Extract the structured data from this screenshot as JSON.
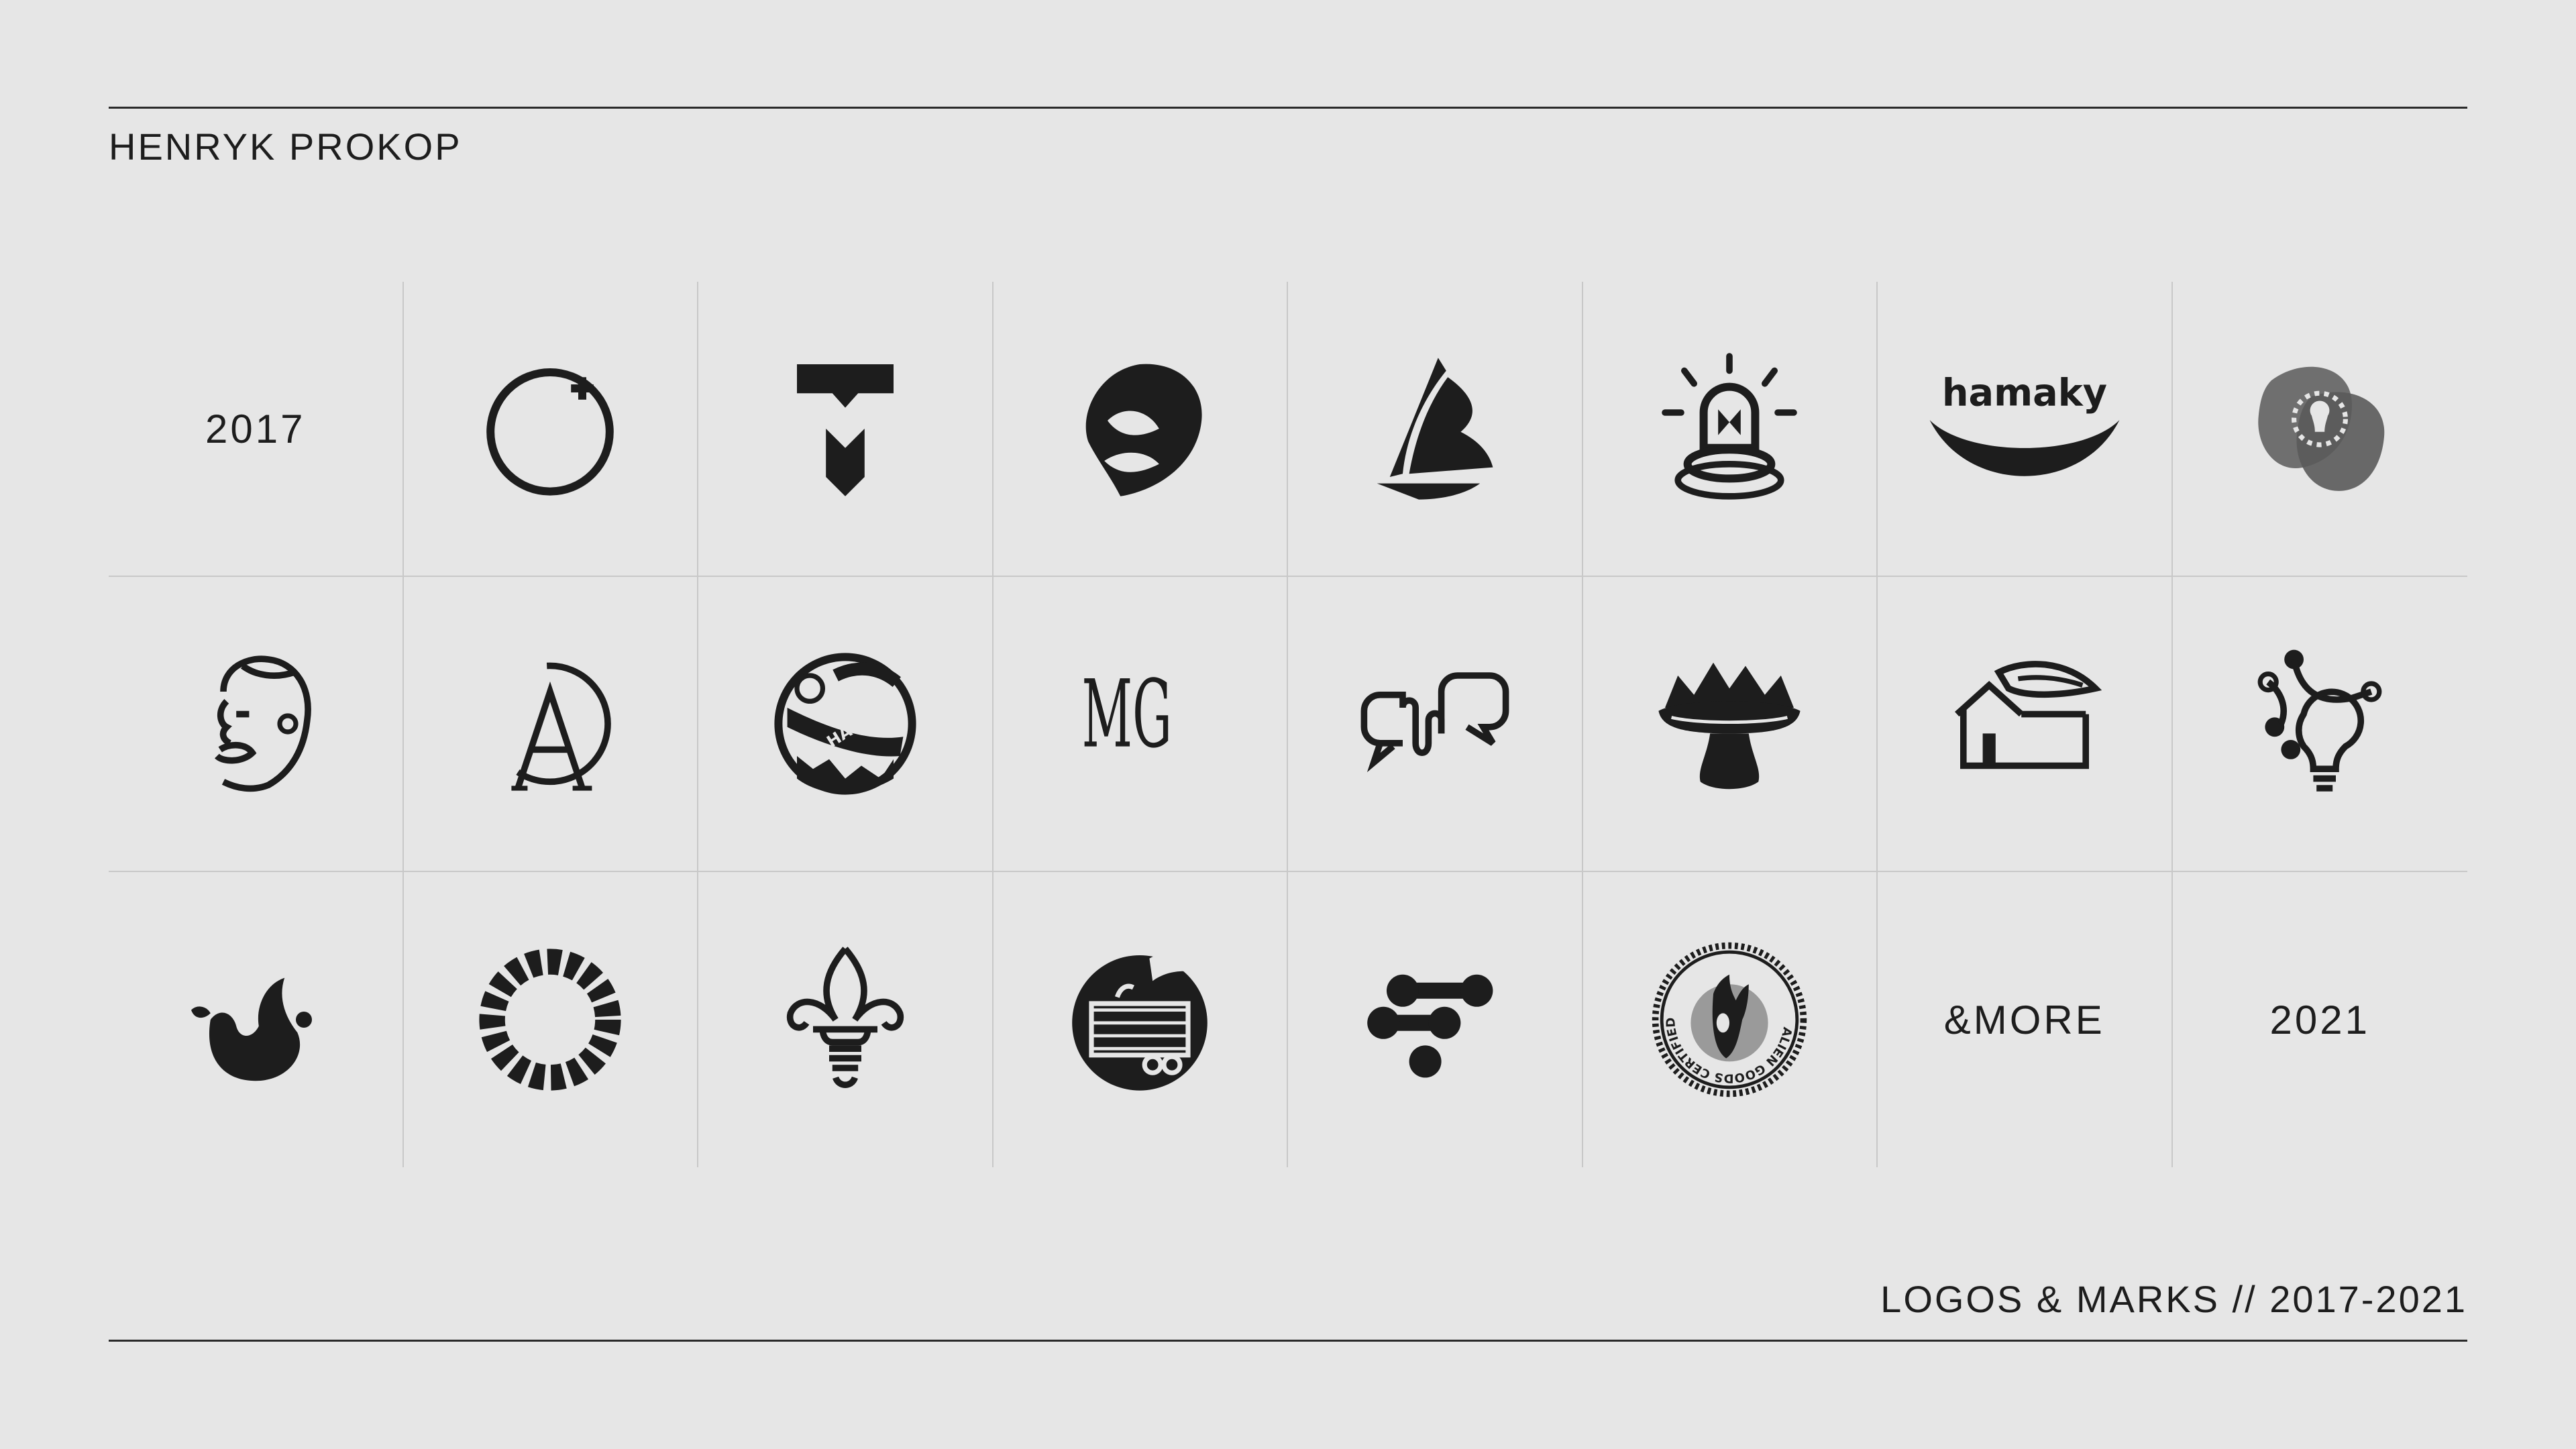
{
  "header": {
    "author": "HENRYK PROKOP"
  },
  "footer": {
    "caption": "LOGOS & MARKS // 2017-2021"
  },
  "grid": {
    "start_year": "2017",
    "end_year": "2021",
    "more_label": "&MORE",
    "logos": {
      "hamaky_wordmark": "hamaky",
      "hamaky_badge": "HAMAKY",
      "mg_monogram": "MG",
      "alien_goods_text": "ALIEN GOODS CERTIFIED"
    }
  },
  "colors": {
    "background": "#e6e6e6",
    "ink": "#1d1d1d",
    "grid_lines": "#c8c8c8",
    "grey_logo": "#6f6f6f"
  }
}
